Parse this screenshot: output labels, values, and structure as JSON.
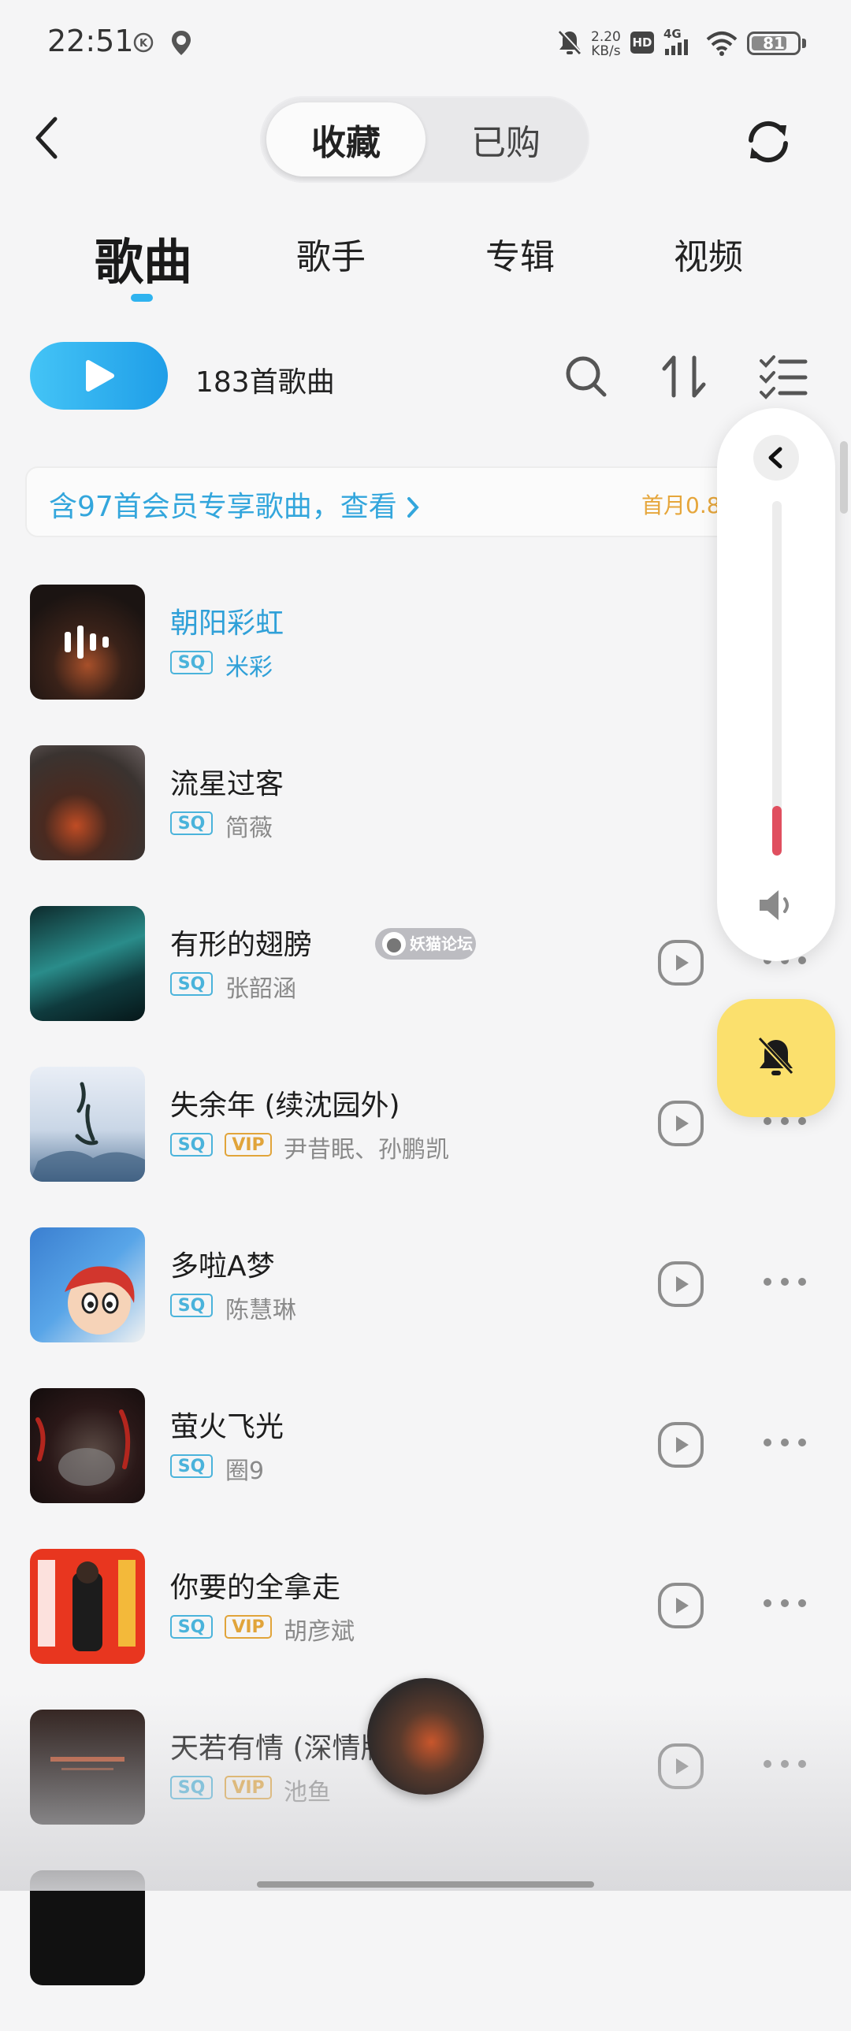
{
  "status_bar": {
    "time": "22:51",
    "net_speed_value": "2.20",
    "net_speed_unit": "KB/s",
    "hd_label": "HD",
    "signal_label": "4G",
    "battery": "81",
    "icons": [
      "k-icon",
      "du-location-icon",
      "mute-bell-icon",
      "hd-icon",
      "signal-icon",
      "wifi-icon",
      "battery-icon"
    ]
  },
  "header": {
    "segments": [
      "收藏",
      "已购"
    ],
    "active_segment": "收藏"
  },
  "tabs": [
    "歌曲",
    "歌手",
    "专辑",
    "视频"
  ],
  "toolbar": {
    "count_label": "183首歌曲"
  },
  "vip_banner": {
    "text": "含97首会员专享歌曲，查看 ",
    "promo": "首月0.8"
  },
  "songs": [
    {
      "title": "朝阳彩虹",
      "tags": [
        "SQ"
      ],
      "artist": "米彩",
      "playing": true
    },
    {
      "title": "流星过客",
      "tags": [
        "SQ"
      ],
      "artist": "简薇",
      "playing": false
    },
    {
      "title": "有形的翅膀",
      "tags": [
        "SQ"
      ],
      "artist": "张韶涵",
      "playing": false
    },
    {
      "title": "失余年 (续沈园外)",
      "tags": [
        "SQ",
        "VIP"
      ],
      "artist": "尹昔眠、孙鹏凯",
      "playing": false
    },
    {
      "title": "多啦A梦",
      "tags": [
        "SQ"
      ],
      "artist": "陈慧琳",
      "playing": false
    },
    {
      "title": "萤火飞光",
      "tags": [
        "SQ"
      ],
      "artist": "圈9",
      "playing": false
    },
    {
      "title": "你要的全拿走",
      "tags": [
        "SQ",
        "VIP"
      ],
      "artist": "胡彦斌",
      "playing": false
    },
    {
      "title": "天若有情 (深情版",
      "tags": [
        "SQ",
        "VIP"
      ],
      "artist": "池鱼",
      "playing": false
    }
  ],
  "tag_labels": {
    "sq": "SQ",
    "vip": "VIP"
  },
  "volume": {
    "level_fraction": 0.14
  },
  "watermark": "妖猫论坛",
  "colors": {
    "accent": "#2fb3ef",
    "playing_title": "#2fa0d8",
    "vip": "#e1a43a",
    "volume_level": "#e04f5f",
    "mute_button": "#fbe06d"
  }
}
